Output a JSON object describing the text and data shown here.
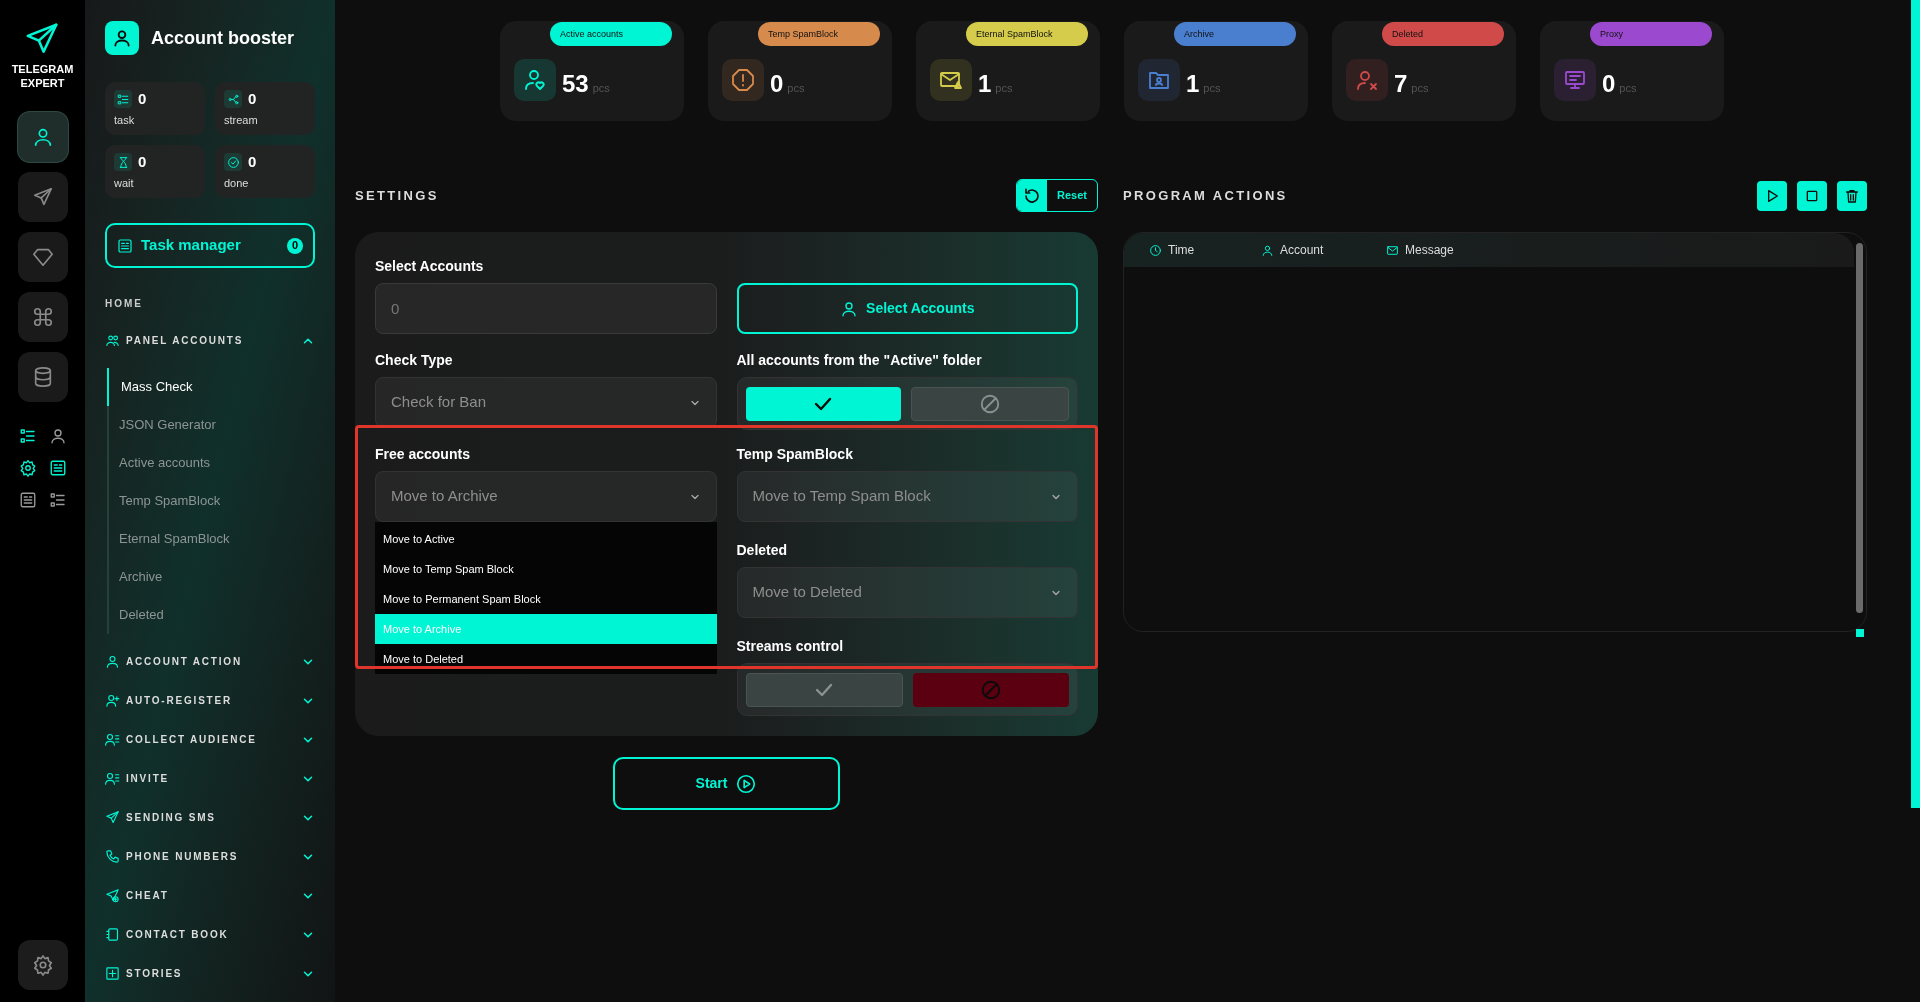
{
  "brand": {
    "line1": "TELEGRAM",
    "line2": "EXPERT"
  },
  "rail": {
    "items": [
      {
        "selected": true
      },
      {
        "selected": false
      },
      {
        "selected": false
      },
      {
        "selected": false
      },
      {
        "selected": false
      }
    ]
  },
  "sidebar": {
    "title": "Account booster",
    "counters": [
      {
        "value": "0",
        "label": "task"
      },
      {
        "value": "0",
        "label": "stream"
      },
      {
        "value": "0",
        "label": "wait"
      },
      {
        "value": "0",
        "label": "done"
      }
    ],
    "task_manager": {
      "label": "Task manager",
      "count": "0"
    },
    "home": "HOME",
    "sections": [
      {
        "label": "PANEL ACCOUNTS",
        "expanded": true,
        "children": [
          {
            "label": "Mass Check",
            "selected": true
          },
          {
            "label": "JSON Generator",
            "selected": false
          },
          {
            "label": "Active accounts",
            "selected": false
          },
          {
            "label": "Temp SpamBlock",
            "selected": false
          },
          {
            "label": "Eternal SpamBlock",
            "selected": false
          },
          {
            "label": "Archive",
            "selected": false
          },
          {
            "label": "Deleted",
            "selected": false
          }
        ]
      },
      {
        "label": "ACCOUNT ACTION",
        "expanded": false
      },
      {
        "label": "AUTO-REGISTER",
        "expanded": false
      },
      {
        "label": "COLLECT AUDIENCE",
        "expanded": false
      },
      {
        "label": "INVITE",
        "expanded": false
      },
      {
        "label": "SENDING SMS",
        "expanded": false
      },
      {
        "label": "PHONE NUMBERS",
        "expanded": false
      },
      {
        "label": "CHEAT",
        "expanded": false
      },
      {
        "label": "CONTACT BOOK",
        "expanded": false
      },
      {
        "label": "STORIES",
        "expanded": false
      }
    ]
  },
  "stats": [
    {
      "label": "Active accounts",
      "value": "53",
      "unit": "pcs",
      "color": "#00f5d4"
    },
    {
      "label": "Temp SpamBlock",
      "value": "0",
      "unit": "pcs",
      "color": "#d68a4c"
    },
    {
      "label": "Eternal SpamBlock",
      "value": "1",
      "unit": "pcs",
      "color": "#d4cc4a"
    },
    {
      "label": "Archive",
      "value": "1",
      "unit": "pcs",
      "color": "#4a7fd0"
    },
    {
      "label": "Deleted",
      "value": "7",
      "unit": "pcs",
      "color": "#d04a4a"
    },
    {
      "label": "Proxy",
      "value": "0",
      "unit": "pcs",
      "color": "#9b4ad0"
    }
  ],
  "settings": {
    "title": "SETTINGS",
    "reset": "Reset",
    "select_accounts": {
      "label": "Select Accounts",
      "placeholder": "0",
      "button": "Select Accounts"
    },
    "check_type": {
      "label": "Check Type",
      "value": "Check for Ban"
    },
    "active_folder": {
      "label": "All accounts from the \"Active\" folder",
      "on": true
    },
    "free_accounts": {
      "label": "Free accounts",
      "value": "Move to Archive",
      "options": [
        {
          "label": "Move to Active",
          "selected": false
        },
        {
          "label": "Move to Temp Spam Block",
          "selected": false
        },
        {
          "label": "Move to Permanent Spam Block",
          "selected": false
        },
        {
          "label": "Move to Archive",
          "selected": true
        },
        {
          "label": "Move to Deleted",
          "selected": false
        }
      ]
    },
    "temp_spamblock": {
      "label": "Temp SpamBlock",
      "value": "Move to Temp Spam Block"
    },
    "deleted": {
      "label": "Deleted",
      "value": "Move to Deleted"
    },
    "streams_control": {
      "label": "Streams control",
      "on": false
    },
    "start": "Start"
  },
  "program_actions": {
    "title": "PROGRAM ACTIONS",
    "columns": [
      "Time",
      "Account",
      "Message"
    ]
  }
}
